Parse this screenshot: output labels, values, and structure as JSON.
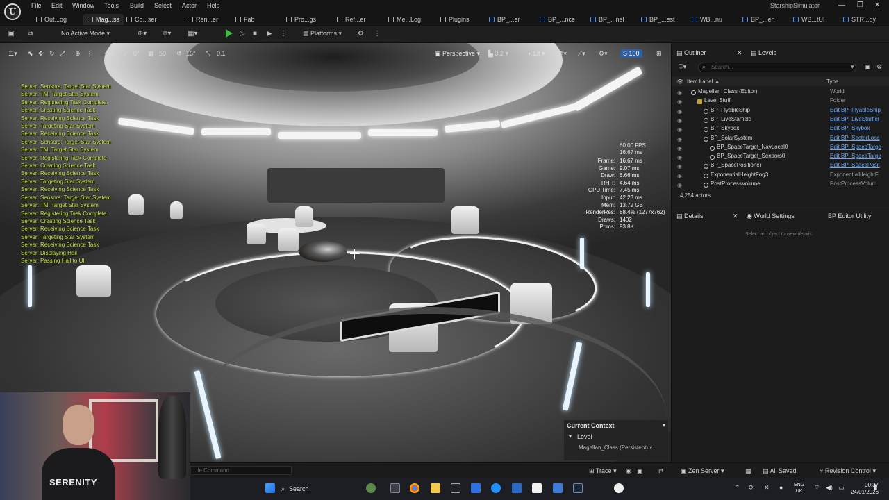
{
  "app": {
    "project_title": "StarshipSimulator",
    "menu": [
      "File",
      "Edit",
      "Window",
      "Tools",
      "Build",
      "Select",
      "Actor",
      "Help"
    ],
    "window_controls": [
      "—",
      "❐",
      "✕"
    ]
  },
  "tabs": [
    {
      "label": "Out...og",
      "active": false
    },
    {
      "label": "Mag...ss",
      "active": true
    },
    {
      "label": "Co...ser",
      "active": false
    },
    {
      "label": "Ren...er",
      "active": false
    },
    {
      "label": "Fab",
      "active": false
    },
    {
      "label": "Pro...gs",
      "active": false
    },
    {
      "label": "Ref...er",
      "active": false
    },
    {
      "label": "Me...Log",
      "active": false
    },
    {
      "label": "Plugins",
      "active": false
    },
    {
      "label": "BP_...er",
      "active": false
    },
    {
      "label": "BP_...nce",
      "active": false
    },
    {
      "label": "BP_...nel",
      "active": false
    },
    {
      "label": "BP_...est",
      "active": false
    },
    {
      "label": "WB...nu",
      "active": false
    },
    {
      "label": "BP_...en",
      "active": false
    },
    {
      "label": "WB...tUI",
      "active": false
    },
    {
      "label": "STR...dy",
      "active": false
    }
  ],
  "toolbar": {
    "mode": "No Active Mode",
    "platforms": "Platforms"
  },
  "viewport_toolbar": {
    "grid_rotation": "0°",
    "grid_snap": "50",
    "rotation_snap": "15°",
    "scale_snap": "0.1",
    "view_mode_perspective": "Perspective",
    "camera_speed": "3.2",
    "lighting": "Lit",
    "realtime_value": "100"
  },
  "server_log": [
    "Server: Sensors: Target Star System",
    "Server: TM: Target Star System",
    "Server: Registering Task Complete",
    "Server: Creating Science Task",
    "Server: Receiving Science Task",
    "Server: Targeting Star System",
    "Server: Receiving Science Task",
    "Server: Sensors: Target Star System",
    "Server: TM: Target Star System",
    "Server: Registering Task Complete",
    "Server: Creating Science Task",
    "Server: Receiving Science Task",
    "Server: Targeting Star System",
    "Server: Receiving Science Task",
    "Server: Sensors: Target Star System",
    "Server: TM: Target Star System",
    "Server: Registering Task Complete",
    "Server: Creating Science Task",
    "Server: Receiving Science Task",
    "Server: Targeting Star System",
    "Server: Receiving Science Task",
    "Server: Displaying Hail",
    "Server: Passing Hail to UI"
  ],
  "stats": {
    "fps": "60.00 FPS",
    "ms": "16.67 ms",
    "rows": [
      {
        "label": "Frame:",
        "value": "16.67 ms"
      },
      {
        "label": "Game:",
        "value": "9.07 ms"
      },
      {
        "label": "Draw:",
        "value": "6.66 ms"
      },
      {
        "label": "RHIT:",
        "value": "4.64 ms"
      },
      {
        "label": "GPU Time:",
        "value": "7.45 ms"
      },
      {
        "label": "Input:",
        "value": "42.23 ms"
      },
      {
        "label": "Mem:",
        "value": "13.72 GB"
      },
      {
        "label": "RenderRes:",
        "value": "88.4% (1277x762)"
      },
      {
        "label": "Draws:",
        "value": "1402"
      },
      {
        "label": "Prims:",
        "value": "93.8K"
      }
    ]
  },
  "context": {
    "header": "Current Context",
    "level": "Level",
    "persistent": "Magellan_Class (Persistent)"
  },
  "webcam": {
    "shirt": "SERENITY"
  },
  "statusbar": {
    "command_placeholder": "...le Command",
    "trace": "Trace",
    "zen": "Zen Server",
    "saved": "All Saved",
    "revision": "Revision Control"
  },
  "taskbar": {
    "search": "Search",
    "lang_top": "ENG",
    "lang_bottom": "UK",
    "time": "00:37",
    "date": "24/01/2026"
  },
  "outliner": {
    "tab": "Outliner",
    "levels_tab": "Levels",
    "search_placeholder": "Search...",
    "col_label": "Item Label ▲",
    "col_type": "Type",
    "rows": [
      {
        "name": "Magellan_Class (Editor)",
        "type": "World",
        "link": false,
        "indent": 0
      },
      {
        "name": "Level Stuff",
        "type": "Folder",
        "link": false,
        "indent": 1
      },
      {
        "name": "BP_FlyableShip",
        "type": "Edit BP_FlyableShip",
        "link": true,
        "indent": 2
      },
      {
        "name": "BP_LiveStarfield",
        "type": "Edit BP_LiveStarfiel",
        "link": true,
        "indent": 2
      },
      {
        "name": "BP_Skybox",
        "type": "Edit BP_Skybox",
        "link": true,
        "indent": 2
      },
      {
        "name": "BP_SolarSystem",
        "type": "Edit BP_SectorLoca",
        "link": true,
        "indent": 2
      },
      {
        "name": "BP_SpaceTarget_NavLocal0",
        "type": "Edit BP_SpaceTarge",
        "link": true,
        "indent": 3
      },
      {
        "name": "BP_SpaceTarget_Sensors0",
        "type": "Edit BP_SpaceTarge",
        "link": true,
        "indent": 3
      },
      {
        "name": "BP_SpacePositioner",
        "type": "Edit BP_SpacePosit",
        "link": true,
        "indent": 2
      },
      {
        "name": "ExponentialHeightFog3",
        "type": "ExponentialHeightF",
        "link": false,
        "indent": 2
      },
      {
        "name": "PostProcessVolume",
        "type": "PostProcessVolum",
        "link": false,
        "indent": 2
      }
    ],
    "actor_count": "4,254 actors"
  },
  "details": {
    "tab": "Details",
    "world_settings": "World Settings",
    "editor_utility": "BP Editor Utility",
    "empty": "Select an object to view details."
  }
}
